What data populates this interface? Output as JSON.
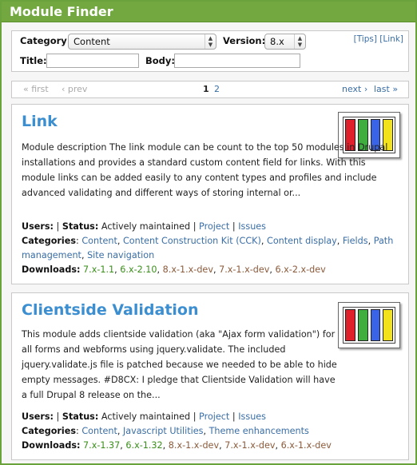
{
  "app": {
    "title": "Module Finder"
  },
  "filters": {
    "category_label": "Category:",
    "category_value": "Content",
    "version_label": "Version:",
    "version_value": "8.x",
    "title_label": "Title:",
    "body_label": "Body:",
    "tips_link": "[Tips]",
    "link_link": "[Link]"
  },
  "pager": {
    "first": "« first",
    "prev": "‹ prev",
    "page1": "1",
    "page2": "2",
    "next": "next ›",
    "last": "last »"
  },
  "labels": {
    "users": "Users:",
    "sep": "|",
    "status": "Status:",
    "categories": "Categories",
    "downloads": "Downloads:",
    "colon": ":",
    "comma": ","
  },
  "modules": [
    {
      "title": "Link",
      "description": "Module description The link module can be count to the top 50 modules in Drupal installations and provides a standard custom content field for links. With this module links can be added easily to any content types and profiles and include advanced validating and different ways of storing internal or...",
      "status": "Actively maintained",
      "project": "Project",
      "issues": "Issues",
      "categories": [
        "Content",
        "Content Construction Kit (CCK)",
        "Content display",
        "Fields",
        "Path management",
        "Site navigation"
      ],
      "downloads": [
        {
          "label": "7.x-1.1",
          "kind": "stable"
        },
        {
          "label": "6.x-2.10",
          "kind": "stable"
        },
        {
          "label": "8.x-1.x-dev",
          "kind": "dev"
        },
        {
          "label": "7.x-1.x-dev",
          "kind": "dev"
        },
        {
          "label": "6.x-2.x-dev",
          "kind": "dev"
        }
      ]
    },
    {
      "title": "Clientside Validation",
      "description": "This module adds clientside validation (aka \"Ajax form validation\") for all forms and webforms using jquery.validate. The included jquery.validate.js file is patched because we needed to be able to hide empty messages. #D8CX: I pledge that Clientside Validation will have a full Drupal 8 release on the...",
      "status": "Actively maintained",
      "project": "Project",
      "issues": "Issues",
      "categories": [
        "Content",
        "Javascript Utilities",
        "Theme enhancements"
      ],
      "downloads": [
        {
          "label": "7.x-1.37",
          "kind": "stable"
        },
        {
          "label": "6.x-1.32",
          "kind": "stable"
        },
        {
          "label": "8.x-1.x-dev",
          "kind": "dev"
        },
        {
          "label": "7.x-1.x-dev",
          "kind": "dev"
        },
        {
          "label": "6.x-1.x-dev",
          "kind": "dev"
        }
      ]
    }
  ],
  "thumb_colors": [
    "#e0212b",
    "#3fae3f",
    "#3a64e8",
    "#f1e21c"
  ]
}
